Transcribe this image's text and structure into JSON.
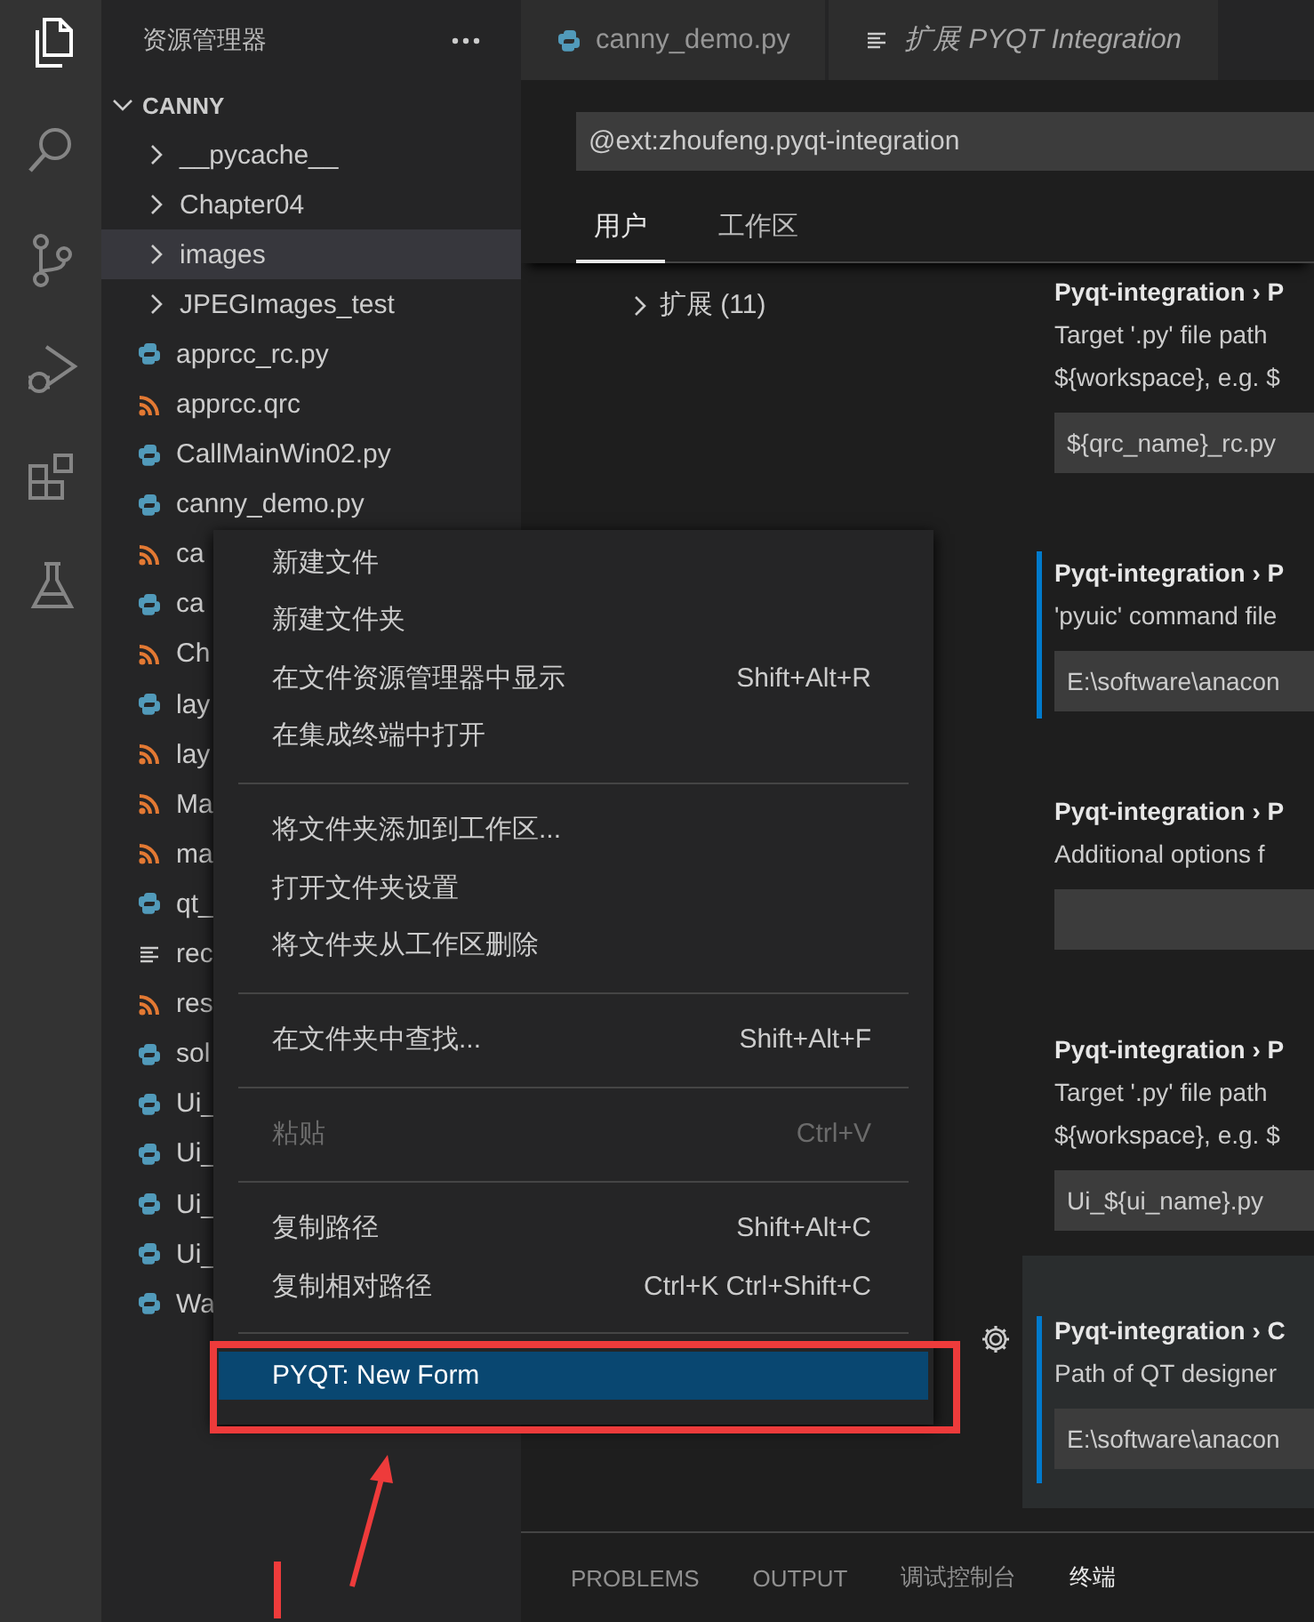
{
  "activity_bar": [
    {
      "kind": "files",
      "selected": true
    },
    {
      "kind": "search",
      "selected": false
    },
    {
      "kind": "source-control",
      "selected": false
    },
    {
      "kind": "debug",
      "selected": false
    },
    {
      "kind": "extensions",
      "selected": false
    },
    {
      "kind": "flask",
      "selected": false
    }
  ],
  "explorer": {
    "title": "资源管理器",
    "root": {
      "name": "CANNY",
      "expanded": true
    },
    "items": [
      {
        "kind": "folder",
        "name": "__pycache__",
        "expanded": false,
        "selected": false
      },
      {
        "kind": "folder",
        "name": "Chapter04",
        "expanded": false,
        "selected": false
      },
      {
        "kind": "folder",
        "name": "images",
        "expanded": false,
        "selected": true
      },
      {
        "kind": "folder",
        "name": "JPEGImages_test",
        "expanded": false,
        "selected": false
      },
      {
        "kind": "python",
        "name": "apprcc_rc.py",
        "selected": false
      },
      {
        "kind": "rss",
        "name": "apprcc.qrc",
        "selected": false
      },
      {
        "kind": "python",
        "name": "CallMainWin02.py",
        "selected": false
      },
      {
        "kind": "python",
        "name": "canny_demo.py",
        "selected": false
      },
      {
        "kind": "rss",
        "name": "ca",
        "selected": false
      },
      {
        "kind": "python",
        "name": "ca",
        "selected": false
      },
      {
        "kind": "rss",
        "name": "Ch",
        "selected": false
      },
      {
        "kind": "python",
        "name": "lay",
        "selected": false
      },
      {
        "kind": "rss",
        "name": "lay",
        "selected": false
      },
      {
        "kind": "rss",
        "name": "Ma",
        "selected": false
      },
      {
        "kind": "rss",
        "name": "ma",
        "selected": false
      },
      {
        "kind": "python",
        "name": "qt_",
        "selected": false
      },
      {
        "kind": "text",
        "name": "rec",
        "selected": false
      },
      {
        "kind": "rss",
        "name": "res",
        "selected": false
      },
      {
        "kind": "python",
        "name": "sol",
        "selected": false
      },
      {
        "kind": "python",
        "name": "Ui_",
        "selected": false
      },
      {
        "kind": "python",
        "name": "Ui_",
        "selected": false
      },
      {
        "kind": "python",
        "name": "Ui_",
        "selected": false
      },
      {
        "kind": "python",
        "name": "Ui_",
        "selected": false
      },
      {
        "kind": "python",
        "name": "Wa",
        "selected": false
      }
    ]
  },
  "editor_tabs": [
    {
      "kind": "python",
      "label": "canny_demo.py",
      "selected": false
    },
    {
      "kind": "preview",
      "label": "扩展 PYQT Integration",
      "selected": true
    }
  ],
  "settings": {
    "search": {
      "value": "@ext:zhoufeng.pyqt-integration"
    },
    "scope_tabs": [
      {
        "label": "用户",
        "selected": true
      },
      {
        "label": "工作区",
        "selected": false
      }
    ],
    "toc": [
      {
        "label": "扩展 (11)",
        "expanded": false
      }
    ],
    "items": [
      {
        "title": "Pyqt-integration › P",
        "description": [
          "Target '.py' file path",
          "${workspace}, e.g. $"
        ],
        "value": "${qrc_name}_rc.py",
        "focused": false,
        "hovered": false
      },
      {
        "title": "Pyqt-integration › P",
        "description": [
          "'pyuic' command file"
        ],
        "value": "E:\\software\\anacon",
        "focused": true,
        "hovered": false
      },
      {
        "title": "Pyqt-integration › P",
        "description": [
          "Additional options f"
        ],
        "focused": false,
        "hovered": false
      },
      {
        "title": "Pyqt-integration › P",
        "description": [
          "Target '.py' file path",
          "${workspace}, e.g. $"
        ],
        "value": "Ui_${ui_name}.py",
        "focused": false,
        "hovered": false
      },
      {
        "title": "Pyqt-integration › C",
        "description": [
          "Path of QT designer"
        ],
        "value": "E:\\software\\anacon",
        "focused": true,
        "hovered": true
      }
    ]
  },
  "panel_tabs": [
    {
      "label": "PROBLEMS",
      "selected": false
    },
    {
      "label": "OUTPUT",
      "selected": false
    },
    {
      "label": "调试控制台",
      "selected": false
    },
    {
      "label": "终端",
      "selected": true
    }
  ],
  "context_menu": {
    "items": [
      {
        "kind": "item",
        "label": "新建文件",
        "disabled": false,
        "selected": false
      },
      {
        "kind": "item",
        "label": "新建文件夹",
        "disabled": false,
        "selected": false
      },
      {
        "kind": "item",
        "label": "在文件资源管理器中显示",
        "shortcut": "Shift+Alt+R",
        "disabled": false,
        "selected": false
      },
      {
        "kind": "item",
        "label": "在集成终端中打开",
        "disabled": false,
        "selected": false
      },
      {
        "kind": "separator"
      },
      {
        "kind": "item",
        "label": "将文件夹添加到工作区...",
        "disabled": false,
        "selected": false
      },
      {
        "kind": "item",
        "label": "打开文件夹设置",
        "disabled": false,
        "selected": false
      },
      {
        "kind": "item",
        "label": "将文件夹从工作区删除",
        "disabled": false,
        "selected": false
      },
      {
        "kind": "separator"
      },
      {
        "kind": "item",
        "label": "在文件夹中查找...",
        "shortcut": "Shift+Alt+F",
        "disabled": false,
        "selected": false
      },
      {
        "kind": "separator"
      },
      {
        "kind": "item",
        "label": "粘贴",
        "shortcut": "Ctrl+V",
        "disabled": true,
        "selected": false
      },
      {
        "kind": "separator"
      },
      {
        "kind": "item",
        "label": "复制路径",
        "shortcut": "Shift+Alt+C",
        "disabled": false,
        "selected": false
      },
      {
        "kind": "item",
        "label": "复制相对路径",
        "shortcut": "Ctrl+K Ctrl+Shift+C",
        "disabled": false,
        "selected": false
      },
      {
        "kind": "separator"
      },
      {
        "kind": "item",
        "label": "PYQT: New Form",
        "disabled": false,
        "selected": true
      }
    ]
  }
}
